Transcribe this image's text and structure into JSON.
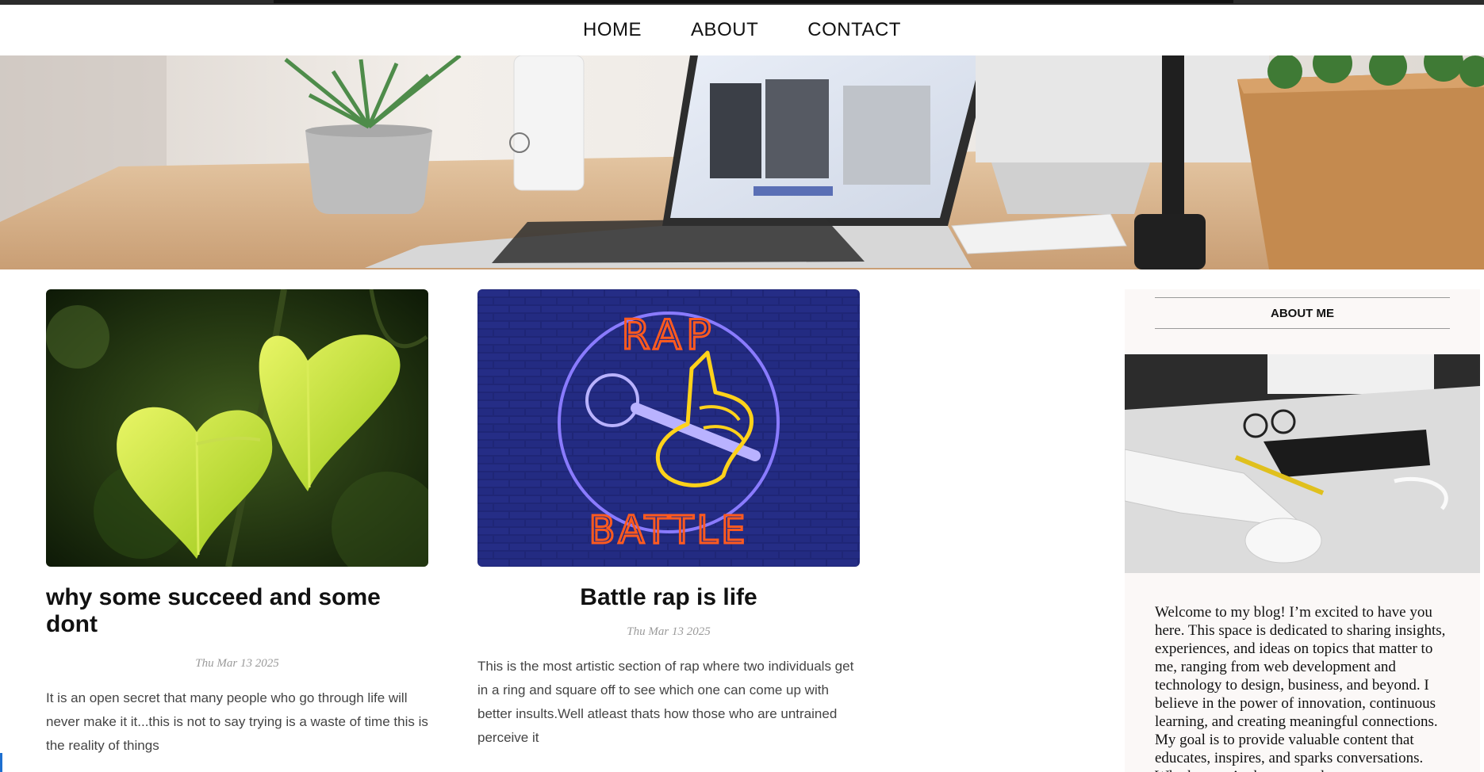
{
  "nav": {
    "items": [
      {
        "label": "HOME"
      },
      {
        "label": "ABOUT"
      },
      {
        "label": "CONTACT"
      }
    ]
  },
  "posts": [
    {
      "title": "why some succeed and some dont",
      "date": "Thu Mar 13 2025",
      "excerpt": "It is an open secret that many people who go through life will never make it it...this is not to say trying is a waste of time this is the reality of things",
      "image_icon": "heart-leaf-plant-image"
    },
    {
      "title": "Battle rap is life",
      "date": "Thu Mar 13 2025",
      "excerpt": "This is the most artistic section of rap where two individuals get in a ring and square off to see which one can come up with better insults.Well atleast thats how those who are untrained perceive it",
      "image_icon": "rap-battle-neon-sign-image",
      "image_text_top": "RAP",
      "image_text_bottom": "BATTLE"
    }
  ],
  "sidebar": {
    "heading": "ABOUT ME",
    "bio": "Welcome to my blog! I’m excited to have you here. This space is dedicated to sharing insights, experiences, and ideas on topics that matter to me, ranging from web development and technology to design, business, and beyond. I believe in the power of innovation, continuous learning, and creating meaningful connections. My goal is to provide valuable content that educates, inspires, and sparks conversations. Whether you’re here to explore"
  },
  "colors": {
    "neon_orange": "#ff5a1f",
    "neon_yellow": "#ffd21a",
    "neon_purple": "#8a7bff",
    "brick_blue": "#1d2470"
  }
}
